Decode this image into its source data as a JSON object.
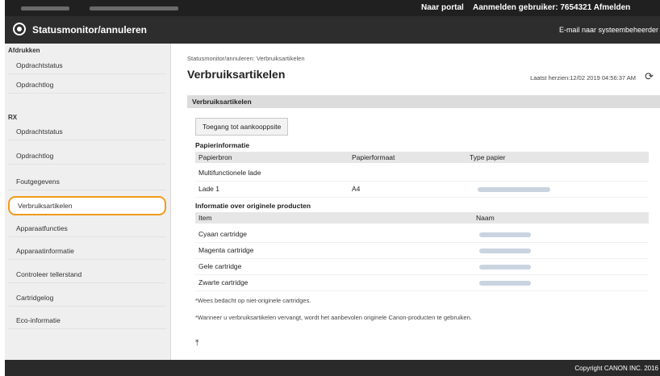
{
  "header": {
    "portal_label": "Naar portal",
    "user_label": "Aanmelden gebruiker:  7654321  Afmelden",
    "app_title": "Statusmonitor/annuleren",
    "mail_link": "E-mail naar systeembeheerder"
  },
  "sidebar": {
    "group_print": "Afdrukken",
    "print_items": [
      "Opdrachtstatus",
      "Opdrachtlog"
    ],
    "group_rx": "RX",
    "rx_items": [
      "Opdrachtstatus",
      "Opdrachtlog"
    ],
    "other_items": [
      "Foutgegevens",
      "Verbruiksartikelen",
      "Apparaatfuncties",
      "Apparaatinformatie",
      "Controleer tellerstand",
      "Cartridgelog",
      "Eco-informatie"
    ]
  },
  "main": {
    "breadcrumb": "Statusmonitor/annuleren: Verbruiksartikelen",
    "title": "Verbruiksartikelen",
    "last_updated": "Laatst herzien:12/02 2019 04:56:37 AM",
    "section_title": "Verbruiksartikelen",
    "purchase_button": "Toegang tot aankooppsite",
    "paper_info": {
      "heading": "Papierinformatie",
      "columns": [
        "Papierbron",
        "Papierformaat",
        "Type papier"
      ],
      "rows": [
        {
          "source": "Multifunctionele lade",
          "size": "",
          "type": ""
        },
        {
          "source": "Lade 1",
          "size": "A4",
          "type": ""
        }
      ]
    },
    "original_info": {
      "heading": "Informatie over originele producten",
      "columns": [
        "Item",
        "Naam"
      ],
      "rows": [
        "Cyaan cartridge",
        "Magenta cartridge",
        "Gele cartridge",
        "Zwarte cartridge"
      ]
    },
    "note1": "*Wees bedacht op niet-originele cartridges.",
    "note2": "*Wanneer u verbruiksartikelen vervangt, wordt het aanbevolen originele Canon-producten te gebruiken."
  },
  "footer": {
    "copyright": "Copyright CANON INC. 2016"
  }
}
